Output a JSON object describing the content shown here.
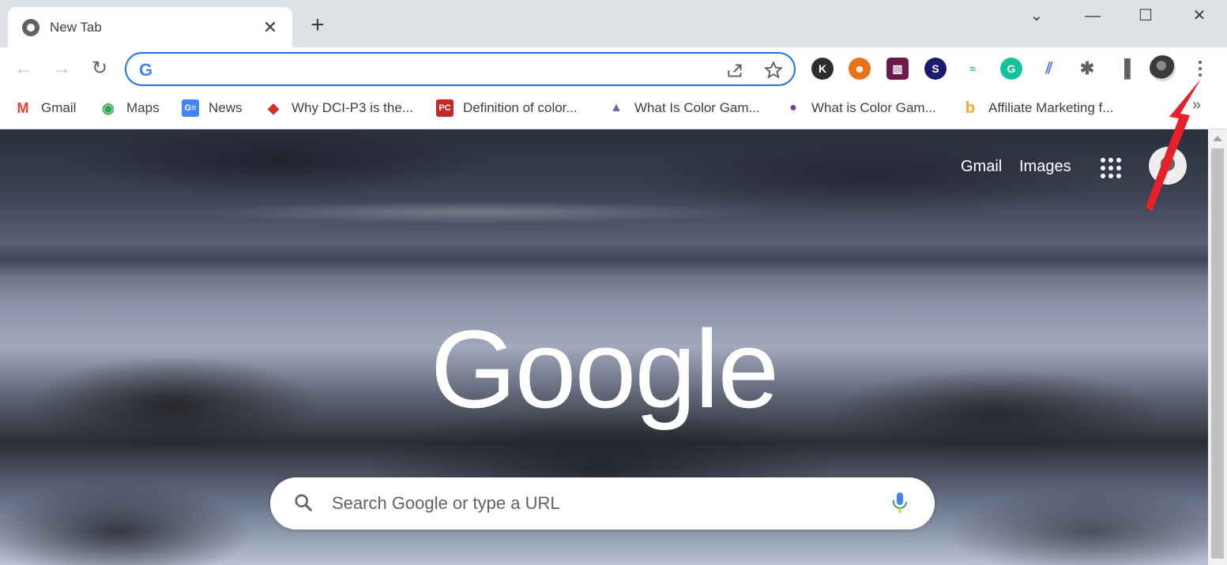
{
  "tab": {
    "title": "New Tab",
    "close": "✕"
  },
  "tabstrip": {
    "new_tab": "+",
    "tab_search": "⌄",
    "minimize": "—",
    "maximize": "☐",
    "close": "✕"
  },
  "toolbar": {
    "back": "←",
    "forward": "→",
    "reload": "↻",
    "omnibox": {
      "value": "",
      "placeholder": "",
      "engine_logo": "G"
    },
    "extensions": [
      {
        "name": "k-extension",
        "glyph": "K",
        "color": "#2d2d2d"
      },
      {
        "name": "robot-extension",
        "glyph": "☻",
        "color": "#e8711a"
      },
      {
        "name": "meter-extension",
        "glyph": "▥",
        "color": "#6a1b4d"
      },
      {
        "name": "s-extension",
        "glyph": "S",
        "color": "#1a1a6e"
      },
      {
        "name": "tools-extension",
        "glyph": "≈",
        "color": "#2bbf8a"
      },
      {
        "name": "grammarly-extension",
        "glyph": "G",
        "color": "#15c39a"
      },
      {
        "name": "chart-extension",
        "glyph": "⫽",
        "color": "#4a6cf7"
      }
    ],
    "puzzle": "✱",
    "side_panel": "▐"
  },
  "bookmarks": [
    {
      "label": "Gmail",
      "icon": "gmail-icon",
      "glyph": "M",
      "color": "#ea4335"
    },
    {
      "label": "Maps",
      "icon": "maps-icon",
      "glyph": "◉",
      "color": "#34a853"
    },
    {
      "label": "News",
      "icon": "news-icon",
      "glyph": "G≡",
      "color": "#4285f4"
    },
    {
      "label": "Why DCI-P3 is the...",
      "icon": "msi-icon",
      "glyph": "◆",
      "color": "#d32f2f"
    },
    {
      "label": "Definition of color...",
      "icon": "pc-icon",
      "glyph": "PC",
      "color": "#c62828"
    },
    {
      "label": "What Is Color Gam...",
      "icon": "gamut-icon",
      "glyph": "▲",
      "color": "#7b5ea7"
    },
    {
      "label": "What is Color Gam...",
      "icon": "benq-icon",
      "glyph": "●",
      "color": "#6a3fa0"
    },
    {
      "label": "Affiliate Marketing f...",
      "icon": "b-icon",
      "glyph": "b",
      "color": "#f5a623"
    }
  ],
  "bookmarks_more": "»",
  "ntp": {
    "gmail": "Gmail",
    "images": "Images",
    "logo": "Google",
    "search_placeholder": "Search Google or type a URL"
  }
}
